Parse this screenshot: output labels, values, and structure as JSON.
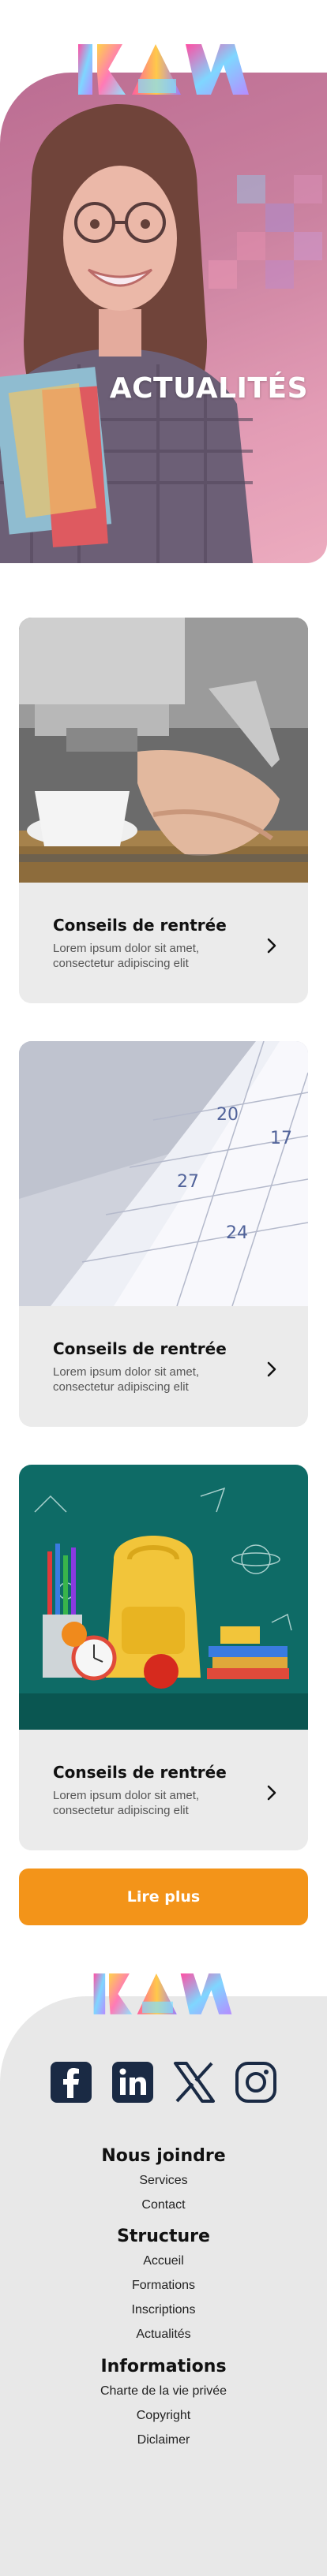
{
  "brand": {
    "logo_text": "IKAM"
  },
  "hero": {
    "title": "ACTUALITÉS"
  },
  "cards": [
    {
      "title": "Conseils de rentrée",
      "text": "Lorem ipsum dolor sit amet, consectetur adipiscing elit",
      "image": "coffee-machine-photo"
    },
    {
      "title": "Conseils de rentrée",
      "text": "Lorem ipsum dolor sit amet, consectetur adipiscing elit",
      "image": "calendar-photo"
    },
    {
      "title": "Conseils de rentrée",
      "text": "Lorem ipsum dolor sit amet, consectetur adipiscing elit",
      "image": "school-backpack-photo"
    }
  ],
  "read_more": {
    "label": "Lire plus"
  },
  "footer": {
    "socials": [
      "facebook-icon",
      "linkedin-icon",
      "x-icon",
      "instagram-icon"
    ],
    "sections": [
      {
        "heading": "Nous joindre",
        "links": [
          "Services",
          "Contact"
        ]
      },
      {
        "heading": "Structure",
        "links": [
          "Accueil",
          "Formations",
          "Inscriptions",
          "Actualités"
        ]
      },
      {
        "heading": "Informations",
        "links": [
          "Charte de la vie privée",
          "Copyright",
          "Diclaimer"
        ]
      }
    ]
  },
  "colors": {
    "accent": "#f39419",
    "card_bg": "#ebebeb",
    "footer_bg": "#e8e8e8",
    "icon_navy": "#1a2a44",
    "hero_pink": "#c77f9d"
  }
}
